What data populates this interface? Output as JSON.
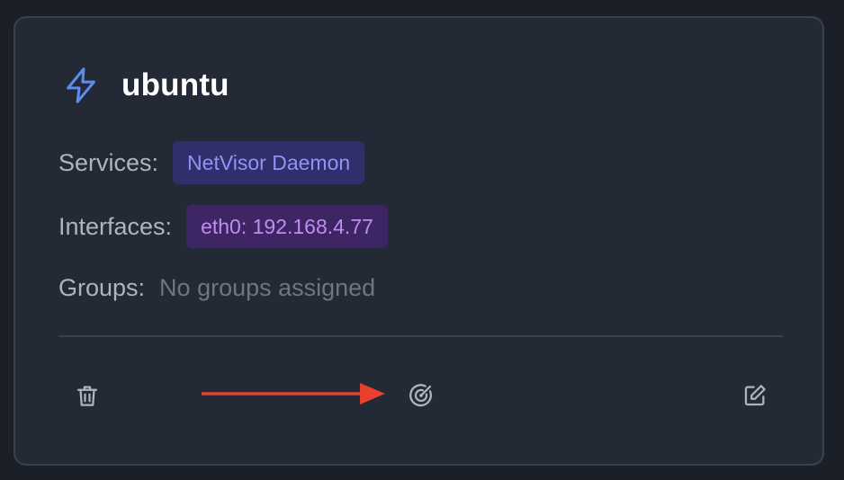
{
  "host": {
    "name": "ubuntu",
    "icon": "lightning-bolt-icon"
  },
  "details": {
    "services_label": "Services:",
    "services": [
      "NetVisor Daemon"
    ],
    "interfaces_label": "Interfaces:",
    "interfaces": [
      "eth0: 192.168.4.77"
    ],
    "groups_label": "Groups:",
    "groups_empty": "No groups assigned"
  },
  "actions": [
    {
      "name": "delete",
      "icon": "trash-icon"
    },
    {
      "name": "scan",
      "icon": "radar-icon"
    },
    {
      "name": "edit",
      "icon": "edit-icon"
    }
  ],
  "annotation": {
    "icon": "red-arrow-icon",
    "color": "#e8402f"
  },
  "colors": {
    "background": "#232935",
    "accent_blue": "#5b8def",
    "service_badge_bg": "#312f6b",
    "service_badge_text": "#8f93f5",
    "interface_badge_bg": "#3e2563",
    "interface_badge_text": "#c08cf2"
  }
}
